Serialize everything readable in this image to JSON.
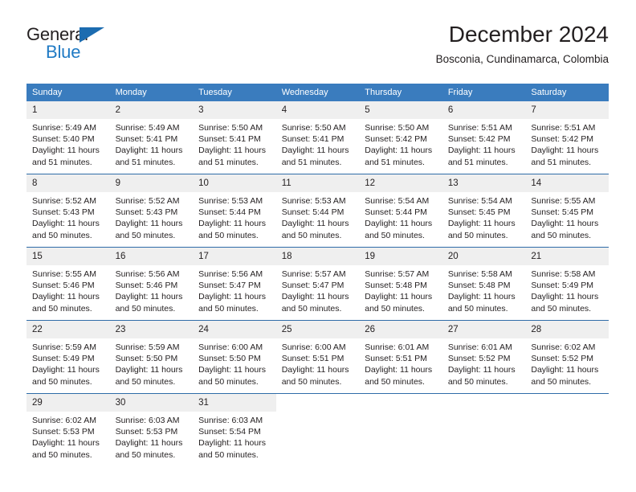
{
  "brand": {
    "name_part1": "General",
    "name_part2": "Blue",
    "accent_color": "#1f7ac4",
    "triangle_color": "#1c6cb0"
  },
  "header": {
    "title": "December 2024",
    "subtitle": "Bosconia, Cundinamarca, Colombia"
  },
  "calendar": {
    "header_bg": "#3a7cbe",
    "row_divider_color": "#2f6ca8",
    "daynum_bg": "#efefef",
    "weekday_headers": [
      "Sunday",
      "Monday",
      "Tuesday",
      "Wednesday",
      "Thursday",
      "Friday",
      "Saturday"
    ],
    "weeks": [
      [
        {
          "day": "1",
          "sunrise": "Sunrise: 5:49 AM",
          "sunset": "Sunset: 5:40 PM",
          "daylight_line1": "Daylight: 11 hours",
          "daylight_line2": "and 51 minutes."
        },
        {
          "day": "2",
          "sunrise": "Sunrise: 5:49 AM",
          "sunset": "Sunset: 5:41 PM",
          "daylight_line1": "Daylight: 11 hours",
          "daylight_line2": "and 51 minutes."
        },
        {
          "day": "3",
          "sunrise": "Sunrise: 5:50 AM",
          "sunset": "Sunset: 5:41 PM",
          "daylight_line1": "Daylight: 11 hours",
          "daylight_line2": "and 51 minutes."
        },
        {
          "day": "4",
          "sunrise": "Sunrise: 5:50 AM",
          "sunset": "Sunset: 5:41 PM",
          "daylight_line1": "Daylight: 11 hours",
          "daylight_line2": "and 51 minutes."
        },
        {
          "day": "5",
          "sunrise": "Sunrise: 5:50 AM",
          "sunset": "Sunset: 5:42 PM",
          "daylight_line1": "Daylight: 11 hours",
          "daylight_line2": "and 51 minutes."
        },
        {
          "day": "6",
          "sunrise": "Sunrise: 5:51 AM",
          "sunset": "Sunset: 5:42 PM",
          "daylight_line1": "Daylight: 11 hours",
          "daylight_line2": "and 51 minutes."
        },
        {
          "day": "7",
          "sunrise": "Sunrise: 5:51 AM",
          "sunset": "Sunset: 5:42 PM",
          "daylight_line1": "Daylight: 11 hours",
          "daylight_line2": "and 51 minutes."
        }
      ],
      [
        {
          "day": "8",
          "sunrise": "Sunrise: 5:52 AM",
          "sunset": "Sunset: 5:43 PM",
          "daylight_line1": "Daylight: 11 hours",
          "daylight_line2": "and 50 minutes."
        },
        {
          "day": "9",
          "sunrise": "Sunrise: 5:52 AM",
          "sunset": "Sunset: 5:43 PM",
          "daylight_line1": "Daylight: 11 hours",
          "daylight_line2": "and 50 minutes."
        },
        {
          "day": "10",
          "sunrise": "Sunrise: 5:53 AM",
          "sunset": "Sunset: 5:44 PM",
          "daylight_line1": "Daylight: 11 hours",
          "daylight_line2": "and 50 minutes."
        },
        {
          "day": "11",
          "sunrise": "Sunrise: 5:53 AM",
          "sunset": "Sunset: 5:44 PM",
          "daylight_line1": "Daylight: 11 hours",
          "daylight_line2": "and 50 minutes."
        },
        {
          "day": "12",
          "sunrise": "Sunrise: 5:54 AM",
          "sunset": "Sunset: 5:44 PM",
          "daylight_line1": "Daylight: 11 hours",
          "daylight_line2": "and 50 minutes."
        },
        {
          "day": "13",
          "sunrise": "Sunrise: 5:54 AM",
          "sunset": "Sunset: 5:45 PM",
          "daylight_line1": "Daylight: 11 hours",
          "daylight_line2": "and 50 minutes."
        },
        {
          "day": "14",
          "sunrise": "Sunrise: 5:55 AM",
          "sunset": "Sunset: 5:45 PM",
          "daylight_line1": "Daylight: 11 hours",
          "daylight_line2": "and 50 minutes."
        }
      ],
      [
        {
          "day": "15",
          "sunrise": "Sunrise: 5:55 AM",
          "sunset": "Sunset: 5:46 PM",
          "daylight_line1": "Daylight: 11 hours",
          "daylight_line2": "and 50 minutes."
        },
        {
          "day": "16",
          "sunrise": "Sunrise: 5:56 AM",
          "sunset": "Sunset: 5:46 PM",
          "daylight_line1": "Daylight: 11 hours",
          "daylight_line2": "and 50 minutes."
        },
        {
          "day": "17",
          "sunrise": "Sunrise: 5:56 AM",
          "sunset": "Sunset: 5:47 PM",
          "daylight_line1": "Daylight: 11 hours",
          "daylight_line2": "and 50 minutes."
        },
        {
          "day": "18",
          "sunrise": "Sunrise: 5:57 AM",
          "sunset": "Sunset: 5:47 PM",
          "daylight_line1": "Daylight: 11 hours",
          "daylight_line2": "and 50 minutes."
        },
        {
          "day": "19",
          "sunrise": "Sunrise: 5:57 AM",
          "sunset": "Sunset: 5:48 PM",
          "daylight_line1": "Daylight: 11 hours",
          "daylight_line2": "and 50 minutes."
        },
        {
          "day": "20",
          "sunrise": "Sunrise: 5:58 AM",
          "sunset": "Sunset: 5:48 PM",
          "daylight_line1": "Daylight: 11 hours",
          "daylight_line2": "and 50 minutes."
        },
        {
          "day": "21",
          "sunrise": "Sunrise: 5:58 AM",
          "sunset": "Sunset: 5:49 PM",
          "daylight_line1": "Daylight: 11 hours",
          "daylight_line2": "and 50 minutes."
        }
      ],
      [
        {
          "day": "22",
          "sunrise": "Sunrise: 5:59 AM",
          "sunset": "Sunset: 5:49 PM",
          "daylight_line1": "Daylight: 11 hours",
          "daylight_line2": "and 50 minutes."
        },
        {
          "day": "23",
          "sunrise": "Sunrise: 5:59 AM",
          "sunset": "Sunset: 5:50 PM",
          "daylight_line1": "Daylight: 11 hours",
          "daylight_line2": "and 50 minutes."
        },
        {
          "day": "24",
          "sunrise": "Sunrise: 6:00 AM",
          "sunset": "Sunset: 5:50 PM",
          "daylight_line1": "Daylight: 11 hours",
          "daylight_line2": "and 50 minutes."
        },
        {
          "day": "25",
          "sunrise": "Sunrise: 6:00 AM",
          "sunset": "Sunset: 5:51 PM",
          "daylight_line1": "Daylight: 11 hours",
          "daylight_line2": "and 50 minutes."
        },
        {
          "day": "26",
          "sunrise": "Sunrise: 6:01 AM",
          "sunset": "Sunset: 5:51 PM",
          "daylight_line1": "Daylight: 11 hours",
          "daylight_line2": "and 50 minutes."
        },
        {
          "day": "27",
          "sunrise": "Sunrise: 6:01 AM",
          "sunset": "Sunset: 5:52 PM",
          "daylight_line1": "Daylight: 11 hours",
          "daylight_line2": "and 50 minutes."
        },
        {
          "day": "28",
          "sunrise": "Sunrise: 6:02 AM",
          "sunset": "Sunset: 5:52 PM",
          "daylight_line1": "Daylight: 11 hours",
          "daylight_line2": "and 50 minutes."
        }
      ],
      [
        {
          "day": "29",
          "sunrise": "Sunrise: 6:02 AM",
          "sunset": "Sunset: 5:53 PM",
          "daylight_line1": "Daylight: 11 hours",
          "daylight_line2": "and 50 minutes."
        },
        {
          "day": "30",
          "sunrise": "Sunrise: 6:03 AM",
          "sunset": "Sunset: 5:53 PM",
          "daylight_line1": "Daylight: 11 hours",
          "daylight_line2": "and 50 minutes."
        },
        {
          "day": "31",
          "sunrise": "Sunrise: 6:03 AM",
          "sunset": "Sunset: 5:54 PM",
          "daylight_line1": "Daylight: 11 hours",
          "daylight_line2": "and 50 minutes."
        },
        {
          "day": "",
          "sunrise": "",
          "sunset": "",
          "daylight_line1": "",
          "daylight_line2": ""
        },
        {
          "day": "",
          "sunrise": "",
          "sunset": "",
          "daylight_line1": "",
          "daylight_line2": ""
        },
        {
          "day": "",
          "sunrise": "",
          "sunset": "",
          "daylight_line1": "",
          "daylight_line2": ""
        },
        {
          "day": "",
          "sunrise": "",
          "sunset": "",
          "daylight_line1": "",
          "daylight_line2": ""
        }
      ]
    ]
  }
}
